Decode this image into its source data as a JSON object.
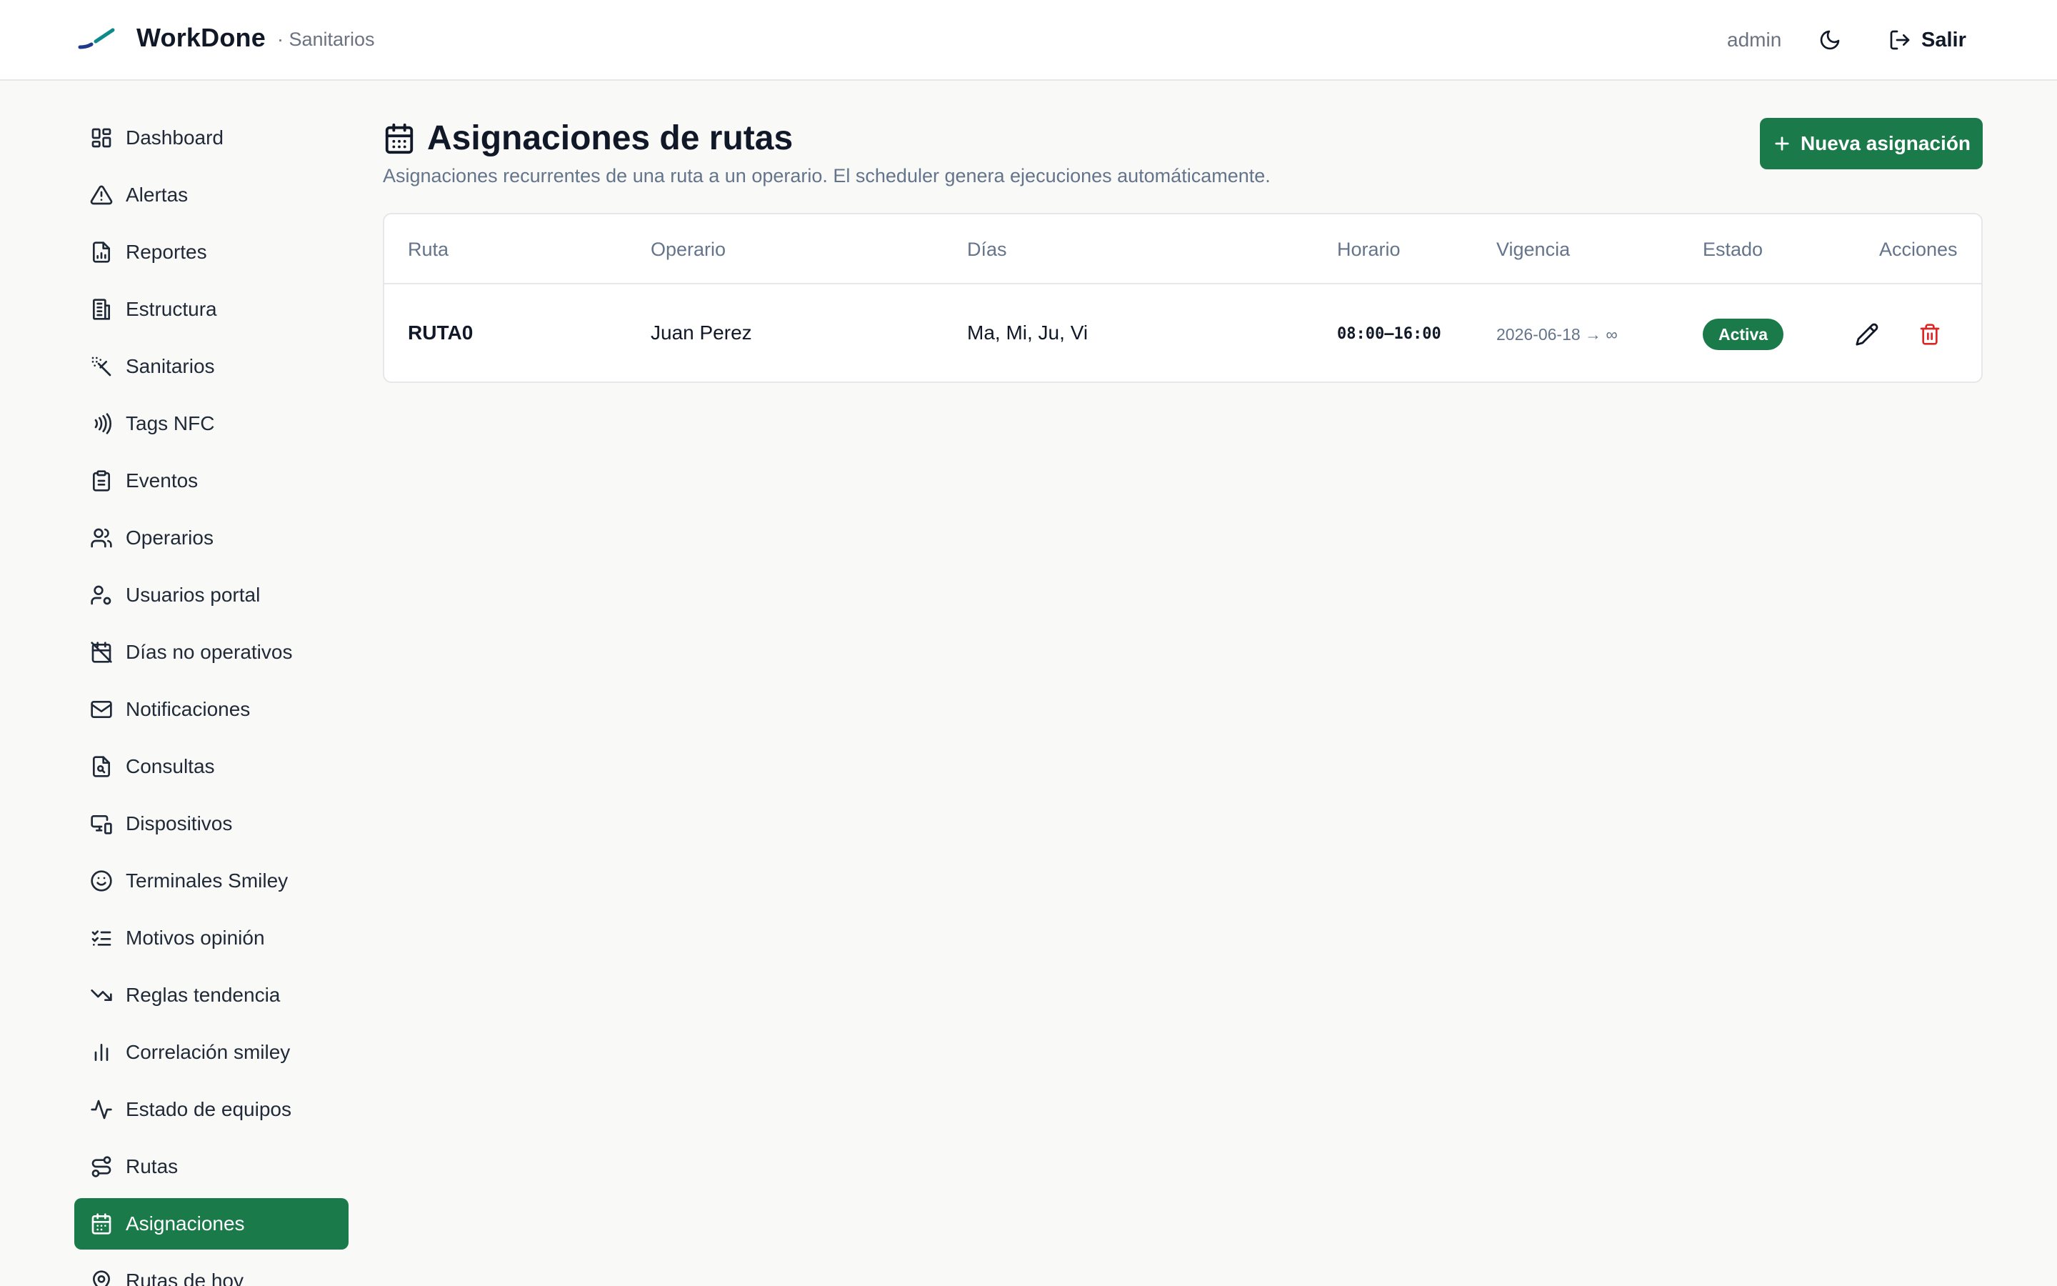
{
  "app": {
    "name": "WorkDone",
    "subtitle": "· Sanitarios",
    "user": "admin",
    "logout_label": "Salir"
  },
  "colors": {
    "accent": "#1a7a4a",
    "danger": "#dc2626",
    "muted": "#64748b",
    "logo_teal": "#0f8a8a",
    "logo_blue": "#1e3a8a"
  },
  "sidebar": {
    "items": [
      {
        "label": "Dashboard",
        "icon": "dashboard-icon",
        "active": false
      },
      {
        "label": "Alertas",
        "icon": "alert-triangle-icon",
        "active": false
      },
      {
        "label": "Reportes",
        "icon": "report-icon",
        "active": false
      },
      {
        "label": "Estructura",
        "icon": "building-icon",
        "active": false
      },
      {
        "label": "Sanitarios",
        "icon": "spray-icon",
        "active": false
      },
      {
        "label": "Tags NFC",
        "icon": "nfc-icon",
        "active": false
      },
      {
        "label": "Eventos",
        "icon": "clipboard-icon",
        "active": false
      },
      {
        "label": "Operarios",
        "icon": "users-icon",
        "active": false
      },
      {
        "label": "Usuarios portal",
        "icon": "user-cog-icon",
        "active": false
      },
      {
        "label": "Días no operativos",
        "icon": "calendar-off-icon",
        "active": false
      },
      {
        "label": "Notificaciones",
        "icon": "mail-icon",
        "active": false
      },
      {
        "label": "Consultas",
        "icon": "file-search-icon",
        "active": false
      },
      {
        "label": "Dispositivos",
        "icon": "devices-icon",
        "active": false
      },
      {
        "label": "Terminales Smiley",
        "icon": "smile-icon",
        "active": false
      },
      {
        "label": "Motivos opinión",
        "icon": "list-checks-icon",
        "active": false
      },
      {
        "label": "Reglas tendencia",
        "icon": "trending-down-icon",
        "active": false
      },
      {
        "label": "Correlación smiley",
        "icon": "bar-chart-icon",
        "active": false
      },
      {
        "label": "Estado de equipos",
        "icon": "activity-icon",
        "active": false
      },
      {
        "label": "Rutas",
        "icon": "route-icon",
        "active": false
      },
      {
        "label": "Asignaciones",
        "icon": "calendar-icon",
        "active": true
      },
      {
        "label": "Rutas de hoy",
        "icon": "map-pin-icon",
        "active": false
      }
    ]
  },
  "main": {
    "title": "Asignaciones de rutas",
    "subtitle": "Asignaciones recurrentes de una ruta a un operario. El scheduler genera ejecuciones automáticamente.",
    "new_button_label": "Nueva asignación",
    "table": {
      "headers": {
        "ruta": "Ruta",
        "operario": "Operario",
        "dias": "Días",
        "horario": "Horario",
        "vigencia": "Vigencia",
        "estado": "Estado",
        "acciones": "Acciones"
      },
      "rows": [
        {
          "ruta": "RUTA0",
          "operario": "Juan Perez",
          "dias": "Ma, Mi, Ju, Vi",
          "horario": "08:00–16:00",
          "vigencia": "2026-06-18 → ∞",
          "estado": "Activa"
        }
      ]
    }
  }
}
